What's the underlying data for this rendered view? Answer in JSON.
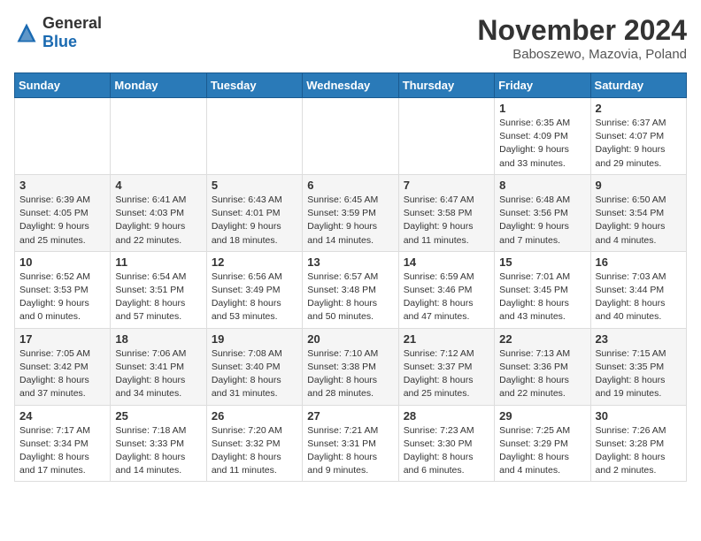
{
  "header": {
    "logo_general": "General",
    "logo_blue": "Blue",
    "month_year": "November 2024",
    "location": "Baboszewo, Mazovia, Poland"
  },
  "calendar": {
    "headers": [
      "Sunday",
      "Monday",
      "Tuesday",
      "Wednesday",
      "Thursday",
      "Friday",
      "Saturday"
    ],
    "weeks": [
      [
        {
          "day": "",
          "info": ""
        },
        {
          "day": "",
          "info": ""
        },
        {
          "day": "",
          "info": ""
        },
        {
          "day": "",
          "info": ""
        },
        {
          "day": "",
          "info": ""
        },
        {
          "day": "1",
          "info": "Sunrise: 6:35 AM\nSunset: 4:09 PM\nDaylight: 9 hours\nand 33 minutes."
        },
        {
          "day": "2",
          "info": "Sunrise: 6:37 AM\nSunset: 4:07 PM\nDaylight: 9 hours\nand 29 minutes."
        }
      ],
      [
        {
          "day": "3",
          "info": "Sunrise: 6:39 AM\nSunset: 4:05 PM\nDaylight: 9 hours\nand 25 minutes."
        },
        {
          "day": "4",
          "info": "Sunrise: 6:41 AM\nSunset: 4:03 PM\nDaylight: 9 hours\nand 22 minutes."
        },
        {
          "day": "5",
          "info": "Sunrise: 6:43 AM\nSunset: 4:01 PM\nDaylight: 9 hours\nand 18 minutes."
        },
        {
          "day": "6",
          "info": "Sunrise: 6:45 AM\nSunset: 3:59 PM\nDaylight: 9 hours\nand 14 minutes."
        },
        {
          "day": "7",
          "info": "Sunrise: 6:47 AM\nSunset: 3:58 PM\nDaylight: 9 hours\nand 11 minutes."
        },
        {
          "day": "8",
          "info": "Sunrise: 6:48 AM\nSunset: 3:56 PM\nDaylight: 9 hours\nand 7 minutes."
        },
        {
          "day": "9",
          "info": "Sunrise: 6:50 AM\nSunset: 3:54 PM\nDaylight: 9 hours\nand 4 minutes."
        }
      ],
      [
        {
          "day": "10",
          "info": "Sunrise: 6:52 AM\nSunset: 3:53 PM\nDaylight: 9 hours\nand 0 minutes."
        },
        {
          "day": "11",
          "info": "Sunrise: 6:54 AM\nSunset: 3:51 PM\nDaylight: 8 hours\nand 57 minutes."
        },
        {
          "day": "12",
          "info": "Sunrise: 6:56 AM\nSunset: 3:49 PM\nDaylight: 8 hours\nand 53 minutes."
        },
        {
          "day": "13",
          "info": "Sunrise: 6:57 AM\nSunset: 3:48 PM\nDaylight: 8 hours\nand 50 minutes."
        },
        {
          "day": "14",
          "info": "Sunrise: 6:59 AM\nSunset: 3:46 PM\nDaylight: 8 hours\nand 47 minutes."
        },
        {
          "day": "15",
          "info": "Sunrise: 7:01 AM\nSunset: 3:45 PM\nDaylight: 8 hours\nand 43 minutes."
        },
        {
          "day": "16",
          "info": "Sunrise: 7:03 AM\nSunset: 3:44 PM\nDaylight: 8 hours\nand 40 minutes."
        }
      ],
      [
        {
          "day": "17",
          "info": "Sunrise: 7:05 AM\nSunset: 3:42 PM\nDaylight: 8 hours\nand 37 minutes."
        },
        {
          "day": "18",
          "info": "Sunrise: 7:06 AM\nSunset: 3:41 PM\nDaylight: 8 hours\nand 34 minutes."
        },
        {
          "day": "19",
          "info": "Sunrise: 7:08 AM\nSunset: 3:40 PM\nDaylight: 8 hours\nand 31 minutes."
        },
        {
          "day": "20",
          "info": "Sunrise: 7:10 AM\nSunset: 3:38 PM\nDaylight: 8 hours\nand 28 minutes."
        },
        {
          "day": "21",
          "info": "Sunrise: 7:12 AM\nSunset: 3:37 PM\nDaylight: 8 hours\nand 25 minutes."
        },
        {
          "day": "22",
          "info": "Sunrise: 7:13 AM\nSunset: 3:36 PM\nDaylight: 8 hours\nand 22 minutes."
        },
        {
          "day": "23",
          "info": "Sunrise: 7:15 AM\nSunset: 3:35 PM\nDaylight: 8 hours\nand 19 minutes."
        }
      ],
      [
        {
          "day": "24",
          "info": "Sunrise: 7:17 AM\nSunset: 3:34 PM\nDaylight: 8 hours\nand 17 minutes."
        },
        {
          "day": "25",
          "info": "Sunrise: 7:18 AM\nSunset: 3:33 PM\nDaylight: 8 hours\nand 14 minutes."
        },
        {
          "day": "26",
          "info": "Sunrise: 7:20 AM\nSunset: 3:32 PM\nDaylight: 8 hours\nand 11 minutes."
        },
        {
          "day": "27",
          "info": "Sunrise: 7:21 AM\nSunset: 3:31 PM\nDaylight: 8 hours\nand 9 minutes."
        },
        {
          "day": "28",
          "info": "Sunrise: 7:23 AM\nSunset: 3:30 PM\nDaylight: 8 hours\nand 6 minutes."
        },
        {
          "day": "29",
          "info": "Sunrise: 7:25 AM\nSunset: 3:29 PM\nDaylight: 8 hours\nand 4 minutes."
        },
        {
          "day": "30",
          "info": "Sunrise: 7:26 AM\nSunset: 3:28 PM\nDaylight: 8 hours\nand 2 minutes."
        }
      ]
    ]
  }
}
